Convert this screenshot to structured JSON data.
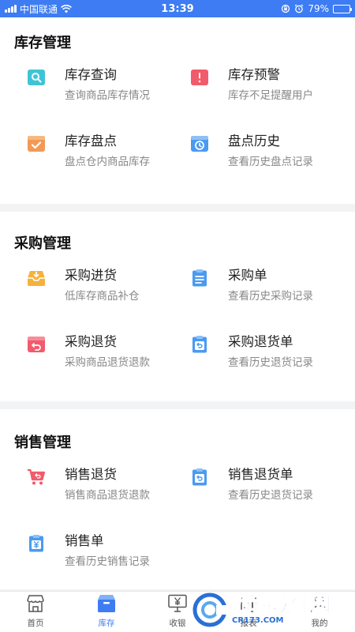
{
  "status": {
    "carrier": "中国联通",
    "time": "13:39",
    "battery": "79%",
    "battery_level": 0.79
  },
  "sections": [
    {
      "title": "库存管理",
      "items": [
        {
          "title": "库存查询",
          "desc": "查询商品库存情况",
          "icon": "search-box-icon",
          "color": "#3fc4d6"
        },
        {
          "title": "库存预警",
          "desc": "库存不足提醒用户",
          "icon": "warning-box-icon",
          "color": "#f25b6b"
        },
        {
          "title": "库存盘点",
          "desc": "盘点仓内商品库存",
          "icon": "check-box-icon",
          "color": "#f29a55"
        },
        {
          "title": "盘点历史",
          "desc": "查看历史盘点记录",
          "icon": "clock-box-icon",
          "color": "#4a9af0"
        }
      ]
    },
    {
      "title": "采购管理",
      "items": [
        {
          "title": "采购进货",
          "desc": "低库存商品补仓",
          "icon": "inbox-tray-icon",
          "color": "#f5b13d"
        },
        {
          "title": "采购单",
          "desc": "查看历史采购记录",
          "icon": "clipboard-list-icon",
          "color": "#4a9af0"
        },
        {
          "title": "采购退货",
          "desc": "采购商品退货退款",
          "icon": "return-box-icon",
          "color": "#f25b6b"
        },
        {
          "title": "采购退货单",
          "desc": "查看历史退货记录",
          "icon": "clipboard-return-icon",
          "color": "#4a9af0"
        }
      ]
    },
    {
      "title": "销售管理",
      "items": [
        {
          "title": "销售退货",
          "desc": "销售商品退货退款",
          "icon": "cart-return-icon",
          "color": "#f25b6b"
        },
        {
          "title": "销售退货单",
          "desc": "查看历史退货记录",
          "icon": "clipboard-return-icon",
          "color": "#4a9af0"
        },
        {
          "title": "销售单",
          "desc": "查看历史销售记录",
          "icon": "clipboard-yen-icon",
          "color": "#4a9af0"
        }
      ]
    }
  ],
  "tabs": [
    {
      "label": "首页",
      "icon": "store-icon",
      "active": false
    },
    {
      "label": "库存",
      "icon": "inventory-box-icon",
      "active": true
    },
    {
      "label": "收银",
      "icon": "cash-register-icon",
      "active": false
    },
    {
      "label": "报表",
      "icon": "report-icon",
      "active": false
    },
    {
      "label": "我的",
      "icon": "user-icon",
      "active": false
    }
  ],
  "watermark": {
    "text": "西西软件园",
    "sub": "CR173.COM"
  },
  "colors": {
    "accent": "#3d7cf2",
    "text": "#222222",
    "subtext": "#888888",
    "divider": "#f2f3f5"
  }
}
